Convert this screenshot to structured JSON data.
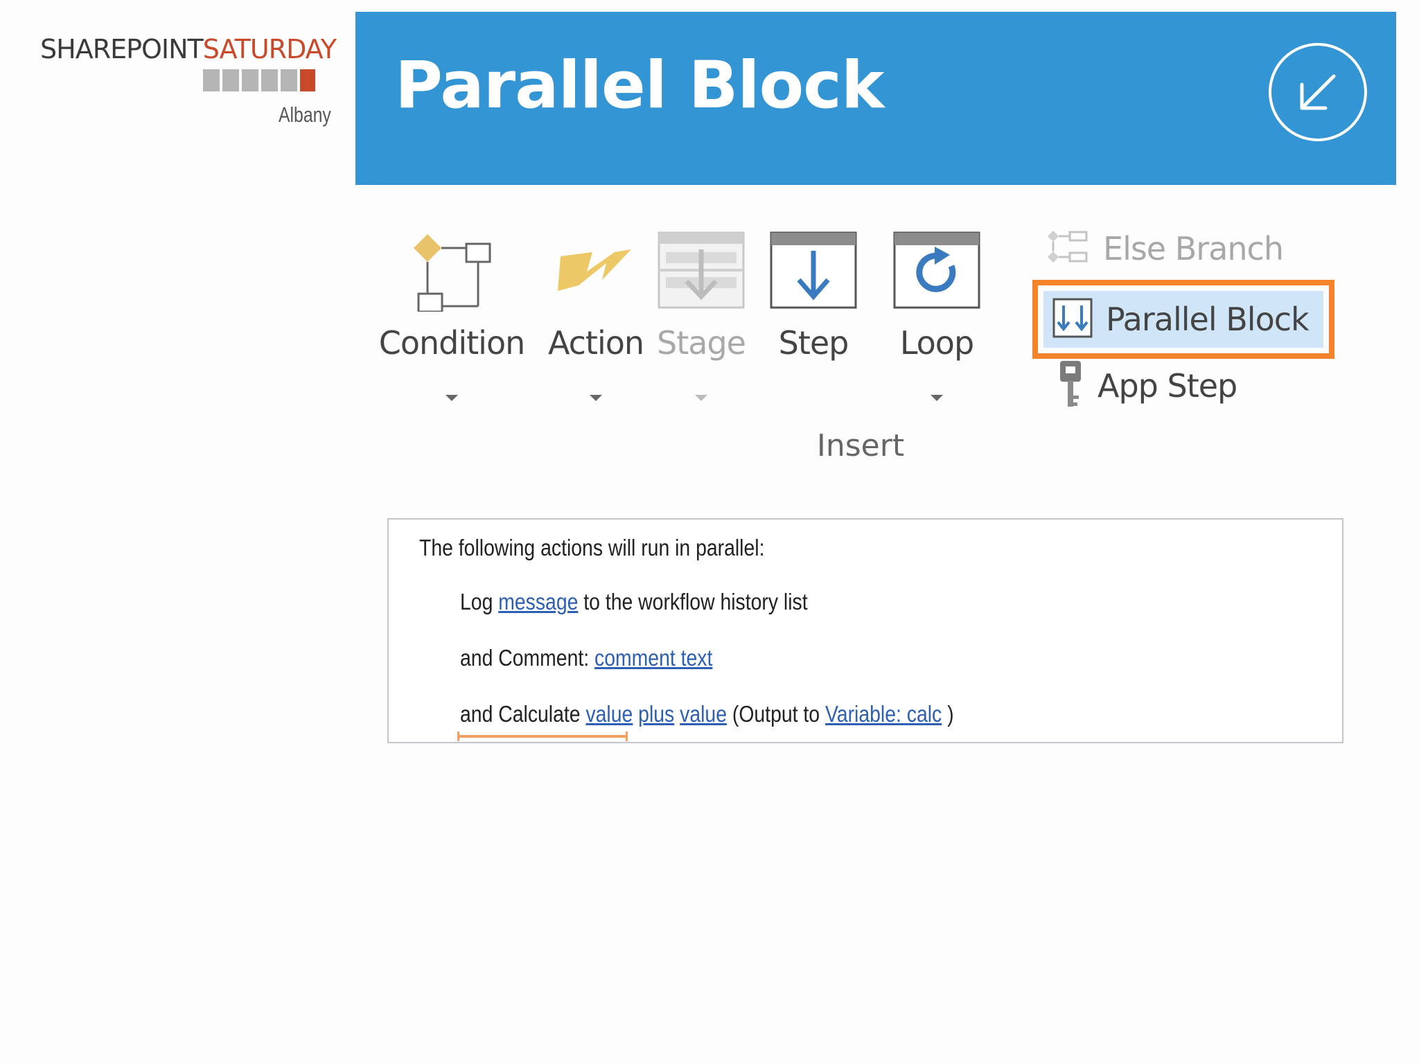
{
  "logo": {
    "brand_part1": "SHAREPOINT",
    "brand_part2": "SATURDAY",
    "city": "Albany",
    "accent_color": "#c94a2a"
  },
  "header": {
    "title": "Parallel Block",
    "icon": "arrow-down-left-circle-icon",
    "background": "#3495d4"
  },
  "ribbon": {
    "buttons": [
      {
        "label": "Condition",
        "icon": "condition-icon",
        "enabled": true,
        "has_dropdown": true
      },
      {
        "label": "Action",
        "icon": "lightning-icon",
        "enabled": true,
        "has_dropdown": true
      },
      {
        "label": "Stage",
        "icon": "stage-icon",
        "enabled": false,
        "has_dropdown": true
      },
      {
        "label": "Step",
        "icon": "step-arrow-icon",
        "enabled": true,
        "has_dropdown": false
      },
      {
        "label": "Loop",
        "icon": "loop-icon",
        "enabled": true,
        "has_dropdown": true
      }
    ],
    "small_items": [
      {
        "label": "Else Branch",
        "icon": "else-branch-icon",
        "enabled": false,
        "selected": false
      },
      {
        "label": "Parallel Block",
        "icon": "parallel-block-icon",
        "enabled": true,
        "selected": true
      },
      {
        "label": "App Step",
        "icon": "key-icon",
        "enabled": true,
        "selected": false
      }
    ],
    "group_label": "Insert",
    "highlight_color": "#f5832a"
  },
  "workflow": {
    "header": "The following actions will run in parallel:",
    "line1": {
      "prefix": "Log ",
      "link": "message",
      "suffix": " to the workflow history list"
    },
    "line2": {
      "prefix": "and Comment: ",
      "link": "comment text"
    },
    "line3": {
      "prefix": "and Calculate ",
      "link1": "value",
      "link2": "plus",
      "link3": "value",
      "middle": " (Output to ",
      "link4": "Variable: calc",
      "suffix": " )"
    }
  }
}
